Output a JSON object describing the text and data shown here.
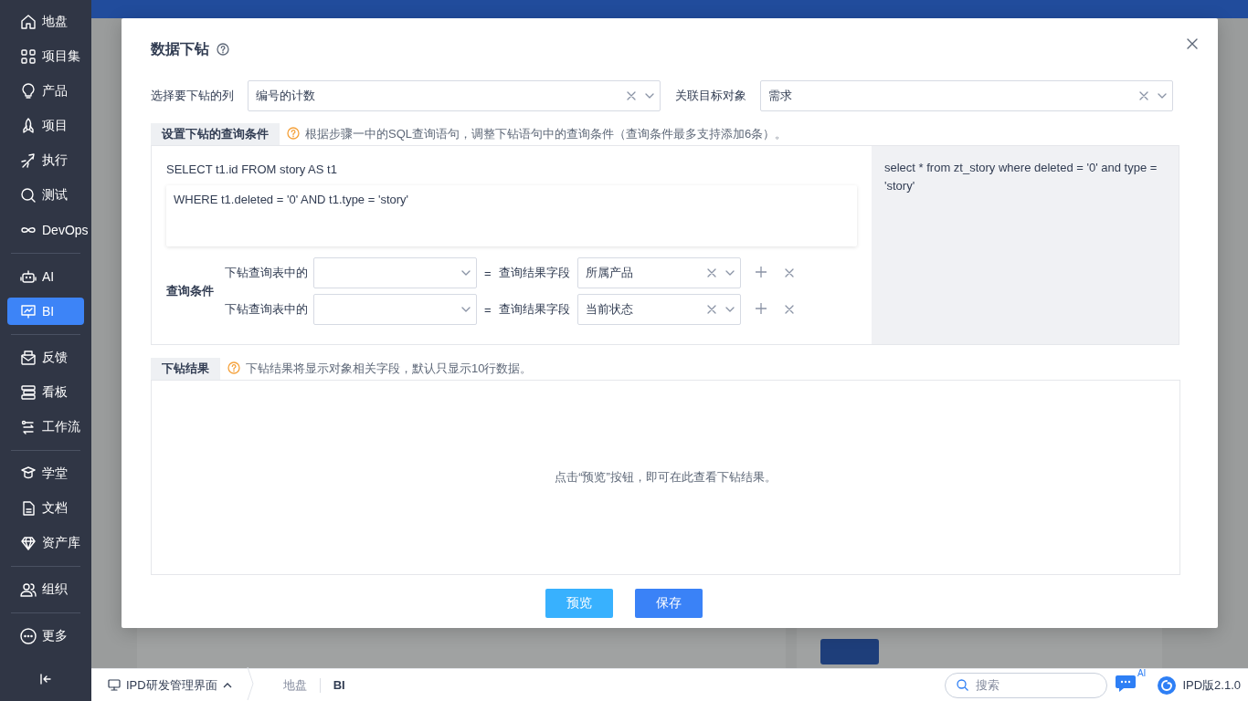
{
  "sidebar": {
    "groups": [
      [
        {
          "label": "地盘",
          "selected": false
        },
        {
          "label": "项目集",
          "selected": false
        },
        {
          "label": "产品",
          "selected": false
        },
        {
          "label": "项目",
          "selected": false
        },
        {
          "label": "执行",
          "selected": false
        },
        {
          "label": "测试",
          "selected": false
        },
        {
          "label": "DevOps",
          "selected": false
        }
      ],
      [
        {
          "label": "AI",
          "selected": false
        },
        {
          "label": "BI",
          "selected": true
        }
      ],
      [
        {
          "label": "反馈",
          "selected": false
        },
        {
          "label": "看板",
          "selected": false
        },
        {
          "label": "工作流",
          "selected": false
        }
      ],
      [
        {
          "label": "学堂",
          "selected": false
        },
        {
          "label": "文档",
          "selected": false
        },
        {
          "label": "资产库",
          "selected": false
        }
      ],
      [
        {
          "label": "组织",
          "selected": false
        }
      ],
      [
        {
          "label": "更多",
          "selected": false
        }
      ]
    ]
  },
  "dialog": {
    "title": "数据下钻",
    "fields": [
      {
        "label": "选择要下钻的列",
        "value": "编号的计数"
      },
      {
        "label": "关联目标对象",
        "value": "需求"
      }
    ],
    "conditions_section": {
      "title": "设置下钻的查询条件",
      "hint": "根据步骤一中的SQL查询语句，调整下钻语句中的查询条件（查询条件最多支持添加6条）。",
      "sql_select": "SELECT t1.id FROM story AS t1",
      "sql_where": "WHERE t1.deleted = '0' AND t1.type = 'story'",
      "conditions_label": "查询条件",
      "conditions": [
        {
          "left_label": "下钻查询表中的",
          "operator": "=",
          "right_label": "查询结果字段",
          "right_value": "所属产品"
        },
        {
          "left_label": "下钻查询表中的",
          "operator": "=",
          "right_label": "查询结果字段",
          "right_value": "当前状态"
        }
      ],
      "preview_sql": "select * from zt_story where deleted = '0' and type = 'story'"
    },
    "results_section": {
      "title": "下钻结果",
      "hint": "下钻结果将显示对象相关字段，默认只显示10行数据。",
      "empty_text": "点击“预览”按钮，即可在此查看下钻结果。"
    },
    "buttons": [
      {
        "label": "预览",
        "kind": "secondary"
      },
      {
        "label": "保存",
        "kind": "primary"
      }
    ]
  },
  "bottom_bar": {
    "workspace": "IPD研发管理界面",
    "breadcrumbs": [
      {
        "label": "地盘",
        "current": false
      },
      {
        "label": "BI",
        "current": true
      }
    ],
    "search_placeholder": "搜索",
    "ai_badge": "AI",
    "version": "IPD版2.1.0"
  }
}
